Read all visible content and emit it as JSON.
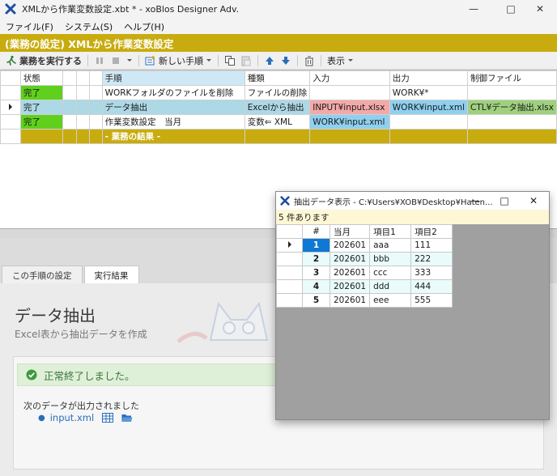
{
  "window": {
    "title": "XMLから作業変数設定.xbt * - xoBlos Designer Adv."
  },
  "menu": [
    "ファイル(F)",
    "システム(S)",
    "ヘルプ(H)"
  ],
  "header": {
    "title": "(業務の設定)  XMLから作業変数設定"
  },
  "toolbar": {
    "run_label": "業務を実行する",
    "new_step_label": "新しい手順",
    "view_label": "表示"
  },
  "grid": {
    "columns": [
      "状態",
      "手順",
      "種類",
      "入力",
      "出力",
      "制御ファイル"
    ],
    "rows": [
      {
        "status": "完了",
        "step": "WORKフォルダのファイルを削除",
        "type": "ファイルの削除",
        "input": "",
        "output": "WORK¥*",
        "control": ""
      },
      {
        "status": "完了",
        "step": "データ抽出",
        "type": "Excelから抽出",
        "input": "INPUT¥input.xlsx",
        "output": "WORK¥input.xml",
        "control": "CTL¥データ抽出.xlsx"
      },
      {
        "status": "完了",
        "step": "作業変数設定　当月",
        "type": "変数⇐ XML",
        "input": "WORK¥input.xml",
        "output": "",
        "control": ""
      }
    ],
    "footer_label": "- 業務の結果 -"
  },
  "tabs": [
    "この手順の設定",
    "実行結果"
  ],
  "detail": {
    "title": "データ抽出",
    "subtitle": "Excel表から抽出データを作成",
    "success_message": "正常終了しました。",
    "output_label": "次のデータが出力されました",
    "output_file": "input.xml"
  },
  "popup": {
    "title": "抽出データ表示 - C:¥Users¥XOB¥Desktop¥Haten...",
    "count_text": "5 件あります",
    "columns": [
      "#",
      "当月",
      "項目1",
      "項目2"
    ],
    "rows": [
      {
        "n": "1",
        "month": "202601",
        "item1": "aaa",
        "item2": "111"
      },
      {
        "n": "2",
        "month": "202601",
        "item1": "bbb",
        "item2": "222"
      },
      {
        "n": "3",
        "month": "202601",
        "item1": "ccc",
        "item2": "333"
      },
      {
        "n": "4",
        "month": "202601",
        "item1": "ddd",
        "item2": "444"
      },
      {
        "n": "5",
        "month": "202601",
        "item1": "eee",
        "item2": "555"
      }
    ]
  },
  "colors": {
    "brand_gold": "#c8ac0f",
    "status_green": "#5fd11c",
    "selected_row": "#add8e6",
    "input_pink": "#f4a9a9",
    "output_blue": "#8fd0ef",
    "control_green": "#9fd07e",
    "success_bg": "#dff0d8",
    "link_blue": "#2a6ebb"
  }
}
